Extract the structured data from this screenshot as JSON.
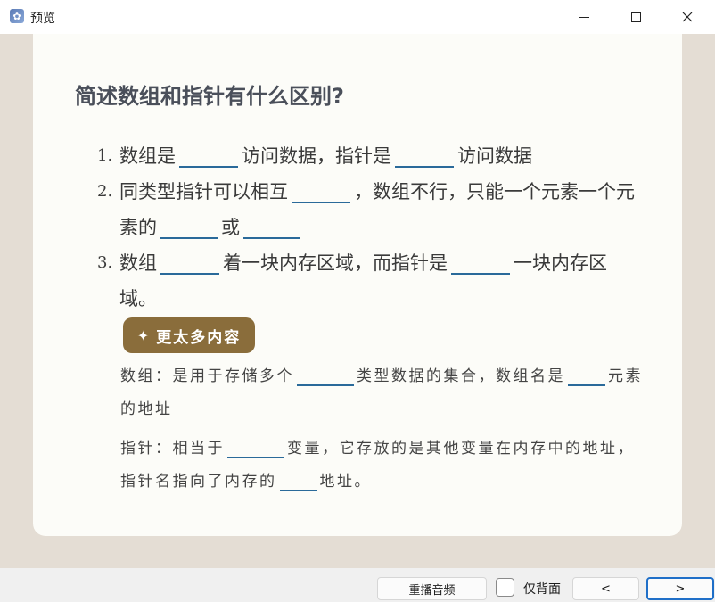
{
  "window": {
    "title": "预览",
    "icon": "app-icon"
  },
  "card": {
    "question": "简述数组和指针有什么区别?",
    "items": [
      {
        "num": "1.",
        "parts": [
          "数组是",
          "访问数据，指针是",
          "访问数据"
        ]
      },
      {
        "num": "2.",
        "parts": [
          "同类型指针可以相互",
          "，数组不行，只能一个元素一个元素的",
          "或",
          ""
        ]
      },
      {
        "num": "3.",
        "parts": [
          "数组",
          "着一块内存区域，而指针是",
          "一块内存区域。"
        ]
      }
    ],
    "more_button": {
      "star": "✦",
      "label": "更太多内容"
    },
    "extra": [
      {
        "parts": [
          "数组：是用于存储多个",
          "类型数据的集合，数组名是",
          "元素的地址"
        ]
      },
      {
        "parts": [
          "指针：相当于",
          "变量，它存放的是其他变量在内存中的地址，指针名指向了内存的",
          "地址。"
        ]
      }
    ]
  },
  "bottombar": {
    "replay_label": "重播音频",
    "checkbox_label": "仅背面",
    "checkbox_checked": false,
    "prev_label": "<",
    "next_label": ">"
  },
  "colors": {
    "background": "#e4ddd4",
    "card": "#fcfcf8",
    "button_brown": "#8a6d3b",
    "blank_line": "#2a6a9a",
    "focus_blue": "#1f6fc8"
  }
}
